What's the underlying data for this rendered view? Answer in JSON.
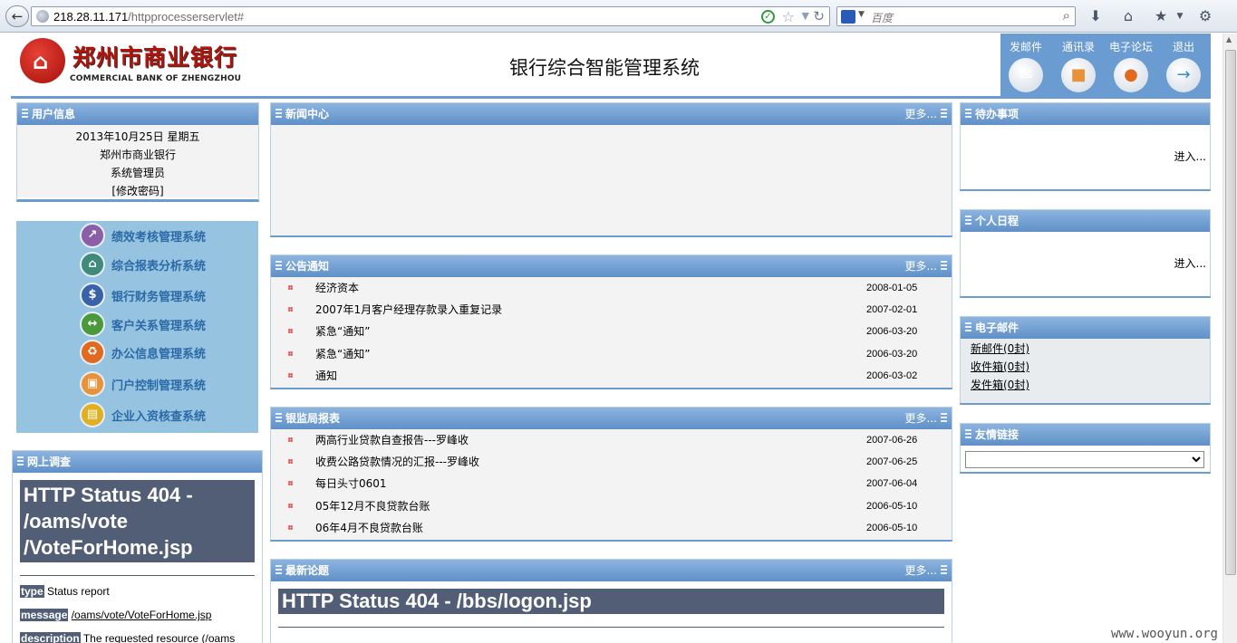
{
  "browser": {
    "url_host": "218.28.11.171",
    "url_path": "/httpprocesserservlet#",
    "search_placeholder": "百度"
  },
  "header": {
    "logo_cn": "郑州市商业银行",
    "logo_en": "COMMERCIAL BANK OF ZHENGZHOU",
    "system_title": "银行综合智能管理系统",
    "links": [
      {
        "label": "发邮件",
        "icon": "mail-icon"
      },
      {
        "label": "通讯录",
        "icon": "address-book-icon"
      },
      {
        "label": "电子论坛",
        "icon": "forum-icon"
      },
      {
        "label": "退出",
        "icon": "exit-icon"
      }
    ]
  },
  "user_info": {
    "title": "用户信息",
    "date": "2013年10月25日 星期五",
    "org": "郑州市商业银行",
    "role": "系统管理员",
    "change_password": "[修改密码]"
  },
  "systems": [
    {
      "label": "绩效考核管理系统",
      "icon": "performance-icon",
      "color": "#8a5fa8"
    },
    {
      "label": "综合报表分析系统",
      "icon": "report-icon",
      "color": "#3f8a7a"
    },
    {
      "label": "银行财务管理系统",
      "icon": "finance-icon",
      "color": "#3a62a8"
    },
    {
      "label": "客户关系管理系统",
      "icon": "customer-icon",
      "color": "#4a9a3c"
    },
    {
      "label": "办公信息管理系统",
      "icon": "office-icon",
      "color": "#e06a20"
    },
    {
      "label": "门户控制管理系统",
      "icon": "portal-icon",
      "color": "#e8933a"
    },
    {
      "label": "企业入资核查系统",
      "icon": "enterprise-icon",
      "color": "#e0b020"
    }
  ],
  "survey": {
    "title": "网上调查",
    "error_title": "HTTP Status 404 - /oams/vote /VoteForHome.jsp",
    "type_key": "type",
    "type_val": "Status report",
    "message_key": "message",
    "message_val": "/oams/vote/VoteForHome.jsp",
    "description_key": "description",
    "description_val": "The requested resource (/oams"
  },
  "news_center": {
    "title": "新闻中心",
    "more": "更多..."
  },
  "announcements": {
    "title": "公告通知",
    "more": "更多...",
    "items": [
      {
        "title": "经济资本",
        "date": "2008-01-05"
      },
      {
        "title": "2007年1月客户经理存款录入重复记录",
        "date": "2007-02-01"
      },
      {
        "title": "紧急“通知”",
        "date": "2006-03-20"
      },
      {
        "title": "紧急“通知”",
        "date": "2006-03-20"
      },
      {
        "title": "通知",
        "date": "2006-03-02"
      }
    ]
  },
  "regulator_reports": {
    "title": "银监局报表",
    "more": "更多...",
    "items": [
      {
        "title": "两高行业贷款自查报告---罗峰收",
        "date": "2007-06-26"
      },
      {
        "title": "收费公路贷款情况的汇报---罗峰收",
        "date": "2007-06-25"
      },
      {
        "title": "每日头寸0601",
        "date": "2007-06-04"
      },
      {
        "title": "05年12月不良贷款台账",
        "date": "2006-05-10"
      },
      {
        "title": "06年4月不良贷款台账",
        "date": "2006-05-10"
      }
    ]
  },
  "forum": {
    "title": "最新论题",
    "more": "更多...",
    "error_title": "HTTP Status 404 - /bbs/logon.jsp"
  },
  "todo": {
    "title": "待办事项",
    "enter": "进入..."
  },
  "schedule": {
    "title": "个人日程",
    "enter": "进入..."
  },
  "email": {
    "title": "电子邮件",
    "new_mail": "新邮件(0封)",
    "inbox": "收件箱(0封)",
    "outbox": "发件箱(0封)"
  },
  "links": {
    "title": "友情链接"
  },
  "watermark": "www.wooyun.org",
  "colors": {
    "accent": "#6a9bd1",
    "menu_bg": "#95c3e0",
    "error_bg": "#525d76",
    "logo_red": "#b2130b"
  }
}
